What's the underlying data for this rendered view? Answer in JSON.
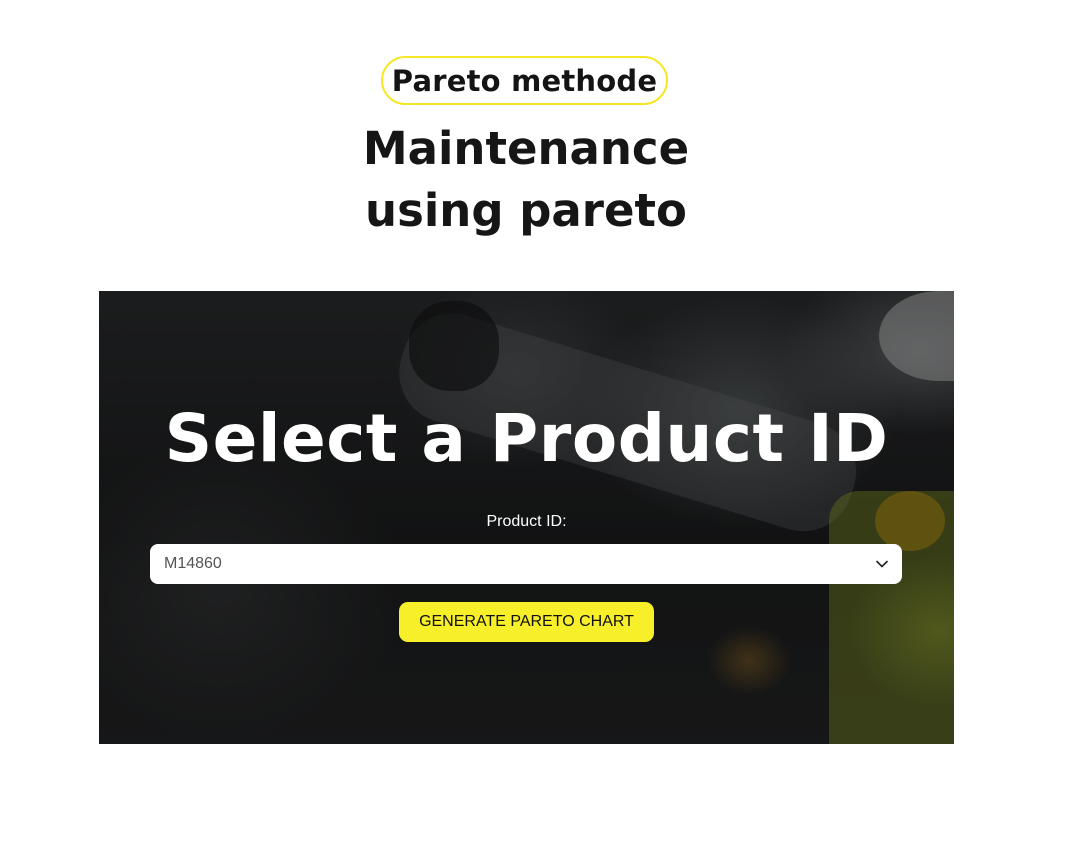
{
  "header": {
    "badge": "Pareto methode",
    "title_line1": "Maintenance",
    "title_line2": "using pareto"
  },
  "hero": {
    "heading": "Select a Product ID",
    "field_label": "Product ID:",
    "select": {
      "selected_value": "M14860"
    },
    "generate_button_label": "GENERATE PARETO CHART"
  },
  "colors": {
    "accent_yellow": "#f7ef2a",
    "pill_border": "#f7e623",
    "text_dark": "#161616"
  },
  "icons": {
    "select_arrow": "chevron-down-icon"
  }
}
